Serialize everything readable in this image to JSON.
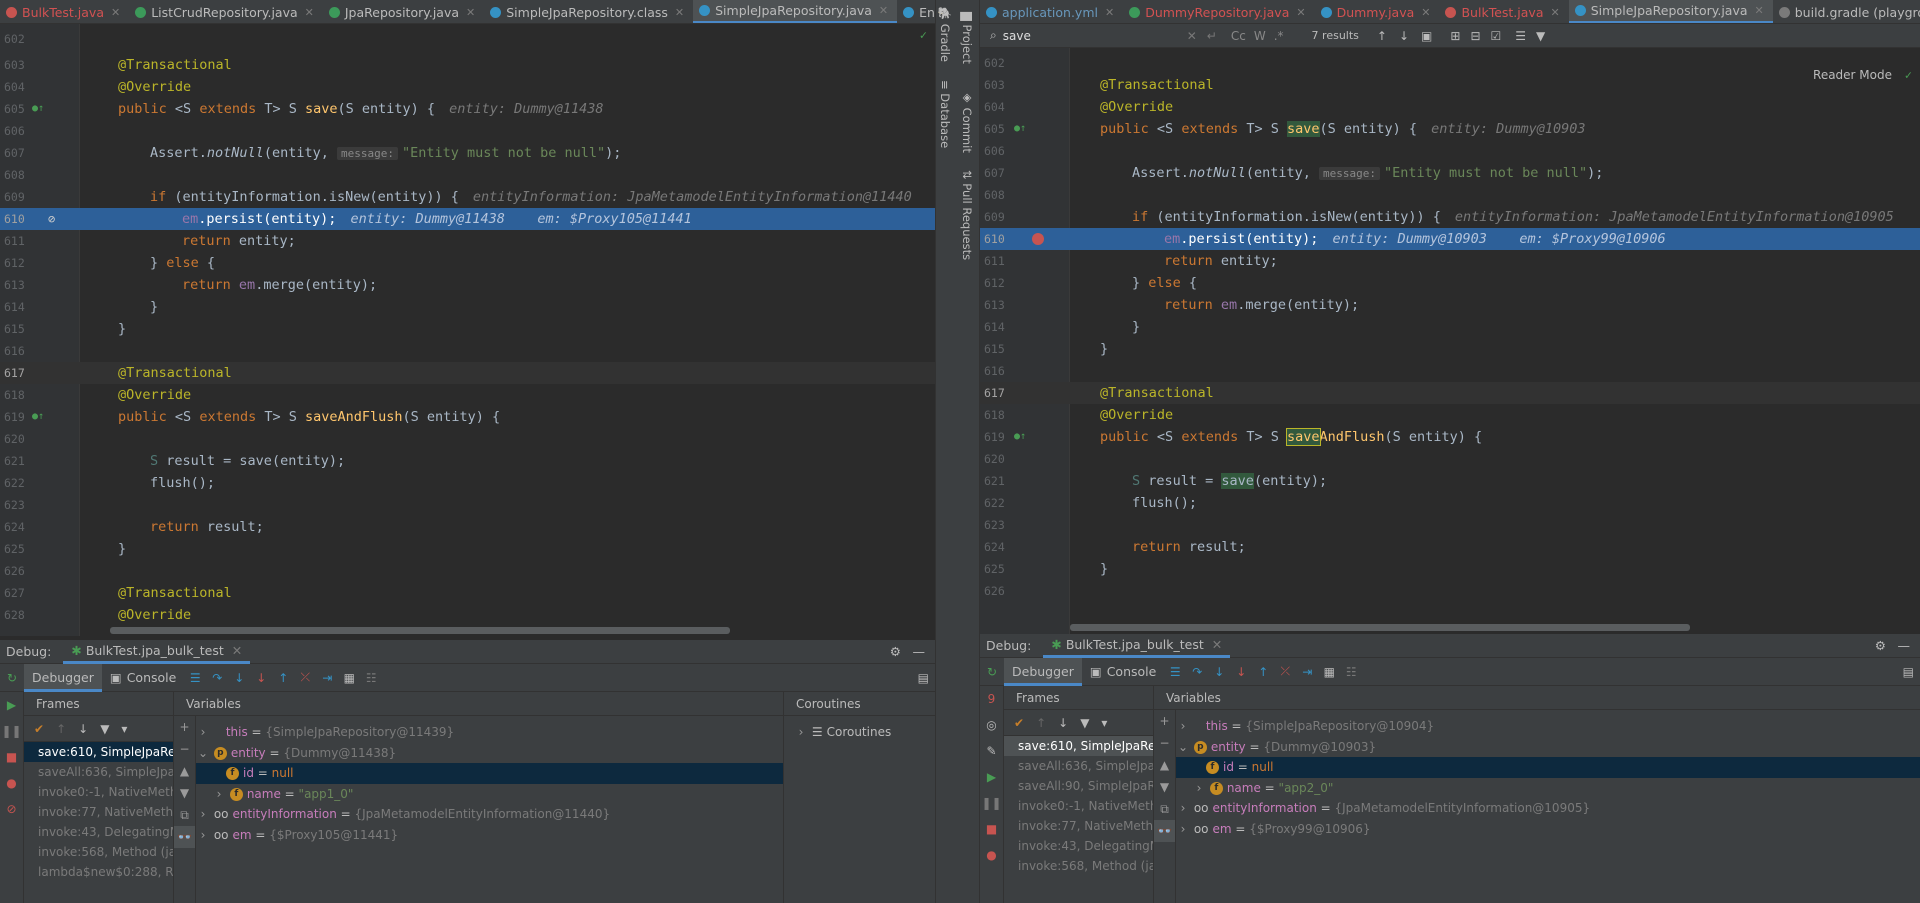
{
  "left": {
    "tabs": [
      {
        "label": "BulkTest.java",
        "icon": "class-icon",
        "red": true,
        "active": false
      },
      {
        "label": "ListCrudRepository.java",
        "icon": "interface-icon",
        "red": false,
        "active": false
      },
      {
        "label": "JpaRepository.java",
        "icon": "interface-icon",
        "red": false,
        "active": false
      },
      {
        "label": "SimpleJpaRepository.class",
        "icon": "class-icon",
        "red": false,
        "active": false
      },
      {
        "label": "SimpleJpaRepository.java",
        "icon": "class-icon",
        "red": false,
        "active": true
      },
      {
        "label": "EntityMa",
        "icon": "class-icon",
        "red": false,
        "active": false
      }
    ],
    "lines": {
      "l602": "602",
      "l603": "603",
      "l604": "604",
      "l605": "605",
      "l606": "606",
      "l607": "607",
      "l608": "608",
      "l609": "609",
      "l610": "610",
      "l611": "611",
      "l612": "612",
      "l613": "613",
      "l614": "614",
      "l615": "615",
      "l616": "616",
      "l617": "617",
      "l618": "618",
      "l619": "619",
      "l620": "620",
      "l621": "621",
      "l622": "622",
      "l623": "623",
      "l624": "624",
      "l625": "625",
      "l626": "626",
      "l627": "627",
      "l628": "628"
    },
    "hints": {
      "save_entity": "entity: Dummy@11438",
      "isnew": "entityInformation: JpaMetamodelEntityInformation@11440",
      "persist": "entity: Dummy@11438    em: $Proxy105@11441"
    },
    "debug": {
      "label": "Debug:",
      "session": "BulkTest.jpa_bulk_test",
      "debugger_tab": "Debugger",
      "console_tab": "Console",
      "frames_header": "Frames",
      "variables_header": "Variables",
      "coroutines_header": "Coroutines",
      "coroutines_item": "Coroutines",
      "frames": [
        "save:610, SimpleJpaRep",
        "saveAll:636, SimpleJpaRe",
        "invoke0:-1, NativeMeth",
        "invoke:77, NativeMetho",
        "invoke:43, DelegatingM",
        "invoke:568, Method (ja",
        "lambda$new$0:288, Re"
      ],
      "vars": {
        "this_name": "this",
        "this_val": "{SimpleJpaRepository@11439}",
        "entity_name": "entity",
        "entity_val": "{Dummy@11438}",
        "id_name": "id",
        "id_val": "null",
        "name_name": "name",
        "name_val": "\"app1_0\"",
        "ei_name": "entityInformation",
        "ei_val": "{JpaMetamodelEntityInformation@11440}",
        "em_name": "em",
        "em_val": "{$Proxy105@11441}"
      }
    }
  },
  "toolstrip": [
    "Gradle",
    "Database",
    "Project",
    "Commit",
    "Pull Requests"
  ],
  "right": {
    "tabs": [
      {
        "label": "application.yml",
        "icon": "yaml-icon",
        "red": false,
        "active": false
      },
      {
        "label": "DummyRepository.java",
        "icon": "interface-icon",
        "red": true,
        "active": false
      },
      {
        "label": "Dummy.java",
        "icon": "class-icon",
        "red": true,
        "active": false
      },
      {
        "label": "BulkTest.java",
        "icon": "class-icon",
        "red": true,
        "active": false
      },
      {
        "label": "SimpleJpaRepository.java",
        "icon": "class-icon",
        "red": false,
        "active": true
      },
      {
        "label": "build.gradle (playground)",
        "icon": "gradle-icon",
        "red": false,
        "active": false
      }
    ],
    "find": {
      "query": "save",
      "results": "7 results",
      "cc": "Cc",
      "w": "W",
      "regex": ".*"
    },
    "reader_mode": "Reader Mode",
    "lines": {
      "l602": "602",
      "l603": "603",
      "l604": "604",
      "l605": "605",
      "l606": "606",
      "l607": "607",
      "l608": "608",
      "l609": "609",
      "l610": "610",
      "l611": "611",
      "l612": "612",
      "l613": "613",
      "l614": "614",
      "l615": "615",
      "l616": "616",
      "l617": "617",
      "l618": "618",
      "l619": "619",
      "l620": "620",
      "l621": "621",
      "l622": "622",
      "l623": "623",
      "l624": "624",
      "l625": "625",
      "l626": "626"
    },
    "hints": {
      "save_entity": "entity: Dummy@10903",
      "isnew": "entityInformation: JpaMetamodelEntityInformation@10905",
      "persist": "entity: Dummy@10903    em: $Proxy99@10906"
    },
    "debug": {
      "label": "Debug:",
      "session": "BulkTest.jpa_bulk_test",
      "debugger_tab": "Debugger",
      "console_tab": "Console",
      "frames_header": "Frames",
      "variables_header": "Variables",
      "frames": [
        "save:610, SimpleJpaRep",
        "saveAll:636, SimpleJpaRe",
        "saveAll:90, SimpleJpaRe",
        "invoke0:-1, NativeMetho",
        "invoke:77, NativeMetho",
        "invoke:43, DelegatingM",
        "invoke:568, Method (ja"
      ],
      "vars": {
        "this_name": "this",
        "this_val": "{SimpleJpaRepository@10904}",
        "entity_name": "entity",
        "entity_val": "{Dummy@10903}",
        "id_name": "id",
        "id_val": "null",
        "name_name": "name",
        "name_val": "\"app2_0\"",
        "ei_name": "entityInformation",
        "ei_val": "{JpaMetamodelEntityInformation@10905}",
        "em_name": "em",
        "em_val": "{$Proxy99@10906}"
      }
    }
  },
  "code": {
    "transactional": "@Transactional",
    "override": "@Override",
    "public": "public",
    "extends": "extends",
    "return": "return",
    "if": "if",
    "else": "else",
    "s_gen": "<S ",
    "t_gen": " T> S ",
    "save": "save",
    "save_params": "(S entity) {",
    "assert_a": "Assert.",
    "notnull": "notNull",
    "assert_b": "(entity, ",
    "message": "message:",
    "entity_msg": "\"Entity must not be null\"",
    "assert_c": ");",
    "if_cond": " (entityInformation.isNew(entity)) {",
    "em": "em",
    "persist": ".persist(entity);",
    "return_entity": " entity;",
    "close_else": "} ",
    "open_brace": " {",
    "merge": ".merge(entity);",
    "close": "}",
    "saveandflush": "saveAndFlush",
    "andflush": "AndFlush",
    "result_a": "S",
    "result_b": " result = ",
    "result_c": "(entity);",
    "flush": "flush();",
    "return_result": " result;"
  }
}
